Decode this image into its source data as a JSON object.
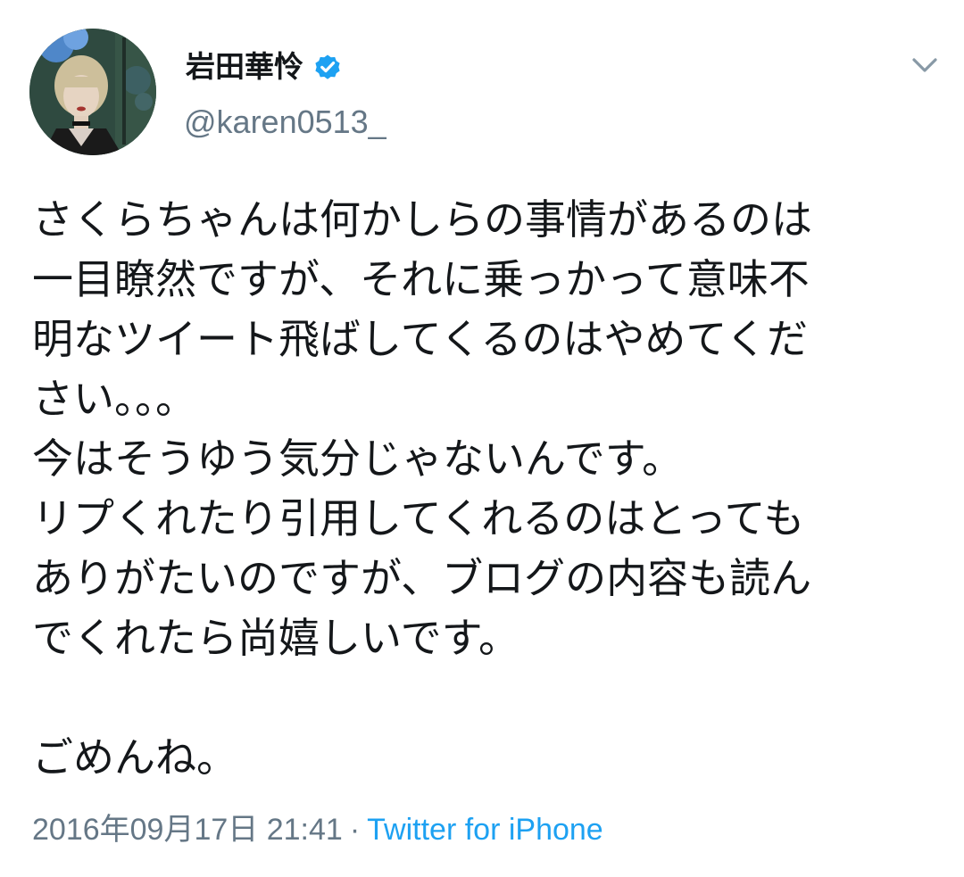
{
  "author": {
    "display_name": "岩田華怜",
    "handle": "@karen0513_",
    "verified": true,
    "verified_icon": "verified-badge-icon",
    "verified_color": "#1da1f2"
  },
  "menu": {
    "icon": "chevron-down-icon"
  },
  "tweet": {
    "lines": [
      "さくらちゃんは何かしらの事情があるのは",
      "一目瞭然ですが、それに乗っかって意味不",
      "明なツイート飛ばしてくるのはやめてくだ",
      "さい。。。",
      "今はそうゆう気分じゃないんです。",
      "リプくれたり引用してくれるのはとっても",
      "ありがたいのですが、ブログの内容も読ん",
      "でくれたら尚嬉しいです。",
      "",
      "ごめんね。"
    ]
  },
  "meta": {
    "timestamp": "2016年09月17日 21:41",
    "separator": "·",
    "source": "Twitter for iPhone"
  },
  "colors": {
    "text": "#14171a",
    "secondary": "#657786",
    "link": "#1da1f2"
  }
}
